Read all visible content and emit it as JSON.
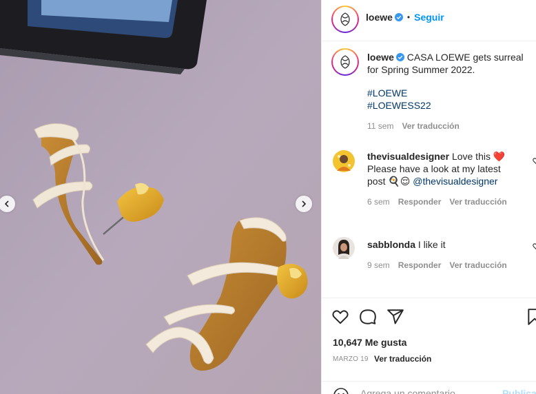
{
  "post": {
    "username": "loewe",
    "follow_label": "Seguir",
    "caption": "CASA LOEWE gets surreal for Spring Summer 2022.",
    "hashtags": [
      "#LOEWE",
      "#LOEWESS22"
    ],
    "caption_time": "11 sem",
    "see_translation": "Ver traducción"
  },
  "comments": [
    {
      "username": "thevisualdesigner",
      "text_line1": "Love this ❤️",
      "text_line2": "Please have a look at my latest",
      "text_line3": "post 🍳😌",
      "mention": "@thevisualdesigner",
      "time": "6 sem",
      "reply": "Responder",
      "see_translation": "Ver traducción"
    },
    {
      "username": "sabblonda",
      "text": "I like it",
      "time": "9 sem",
      "reply": "Responder",
      "see_translation": "Ver traducción"
    }
  ],
  "footer": {
    "likes": "10,647 Me gusta",
    "date": "MARZO 19",
    "see_translation": "Ver traducción",
    "comment_placeholder": "Agrega un comentario...",
    "publish_label": "Publicar"
  },
  "icons": {
    "like": "heart-icon",
    "comment": "comment-icon",
    "share": "share-icon",
    "save": "bookmark-icon",
    "emoji": "emoji-icon",
    "prev": "chevron-left-icon",
    "next": "chevron-right-icon",
    "verified": "verified-badge-icon"
  },
  "colors": {
    "accent": "#0095f6",
    "hashtag": "#00376b",
    "muted": "#8e8e8e",
    "heart_red": "#ed4956"
  }
}
